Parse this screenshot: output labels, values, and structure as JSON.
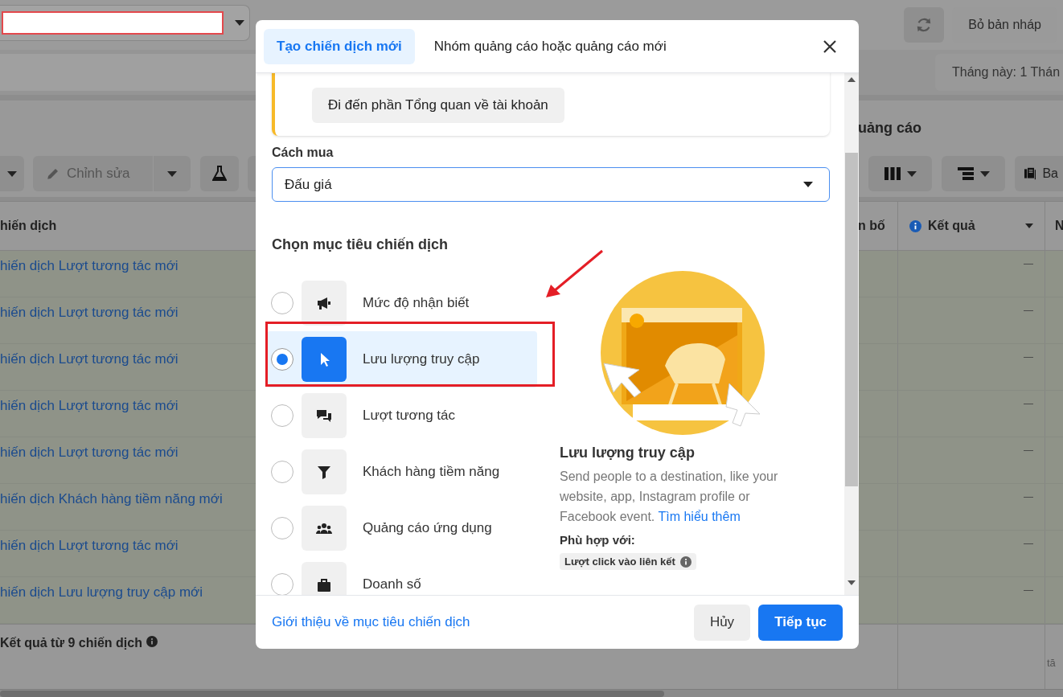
{
  "top_bar": {
    "draft_button": "Bỏ bản nháp"
  },
  "date_range": "Tháng này: 1 Thán",
  "panel_title": "uảng cáo",
  "toolbar": {
    "edit_label": "Chỉnh sửa",
    "partial_label": "Ba"
  },
  "table": {
    "columns": [
      {
        "label": "hiến dịch",
        "kind": "plain"
      },
      {
        "label": "n bố",
        "kind": "plain"
      },
      {
        "label": "Kết quả",
        "kind": "metric"
      },
      {
        "label": "N",
        "kind": "plain"
      }
    ],
    "rows": [
      {
        "name": "hiến dịch Lượt tương tác mới",
        "result": "—"
      },
      {
        "name": "hiến dịch Lượt tương tác mới",
        "result": "—"
      },
      {
        "name": "hiến dịch Lượt tương tác mới",
        "result": "—"
      },
      {
        "name": "hiến dịch Lượt tương tác mới",
        "result": "—"
      },
      {
        "name": "hiến dịch Lượt tương tác mới",
        "result": "—"
      },
      {
        "name": "hiến dịch Khách hàng tiềm năng mới",
        "result": "—"
      },
      {
        "name": "hiến dịch Lượt tương tác mới",
        "result": "—"
      },
      {
        "name": "hiến dịch Lưu lượng truy cập mới",
        "result": "—"
      }
    ],
    "footer": {
      "summary": "Kết quả từ 9 chiến dịch",
      "column_4": "tă"
    }
  },
  "dialog": {
    "tabs": [
      {
        "label": "Tạo chiến dịch mới",
        "selected": true
      },
      {
        "label": "Nhóm quảng cáo hoặc quảng cáo mới",
        "selected": false
      }
    ],
    "notice_button": "Đi đến phần Tổng quan về tài khoản",
    "buying_type": {
      "label": "Cách mua",
      "value": "Đấu giá"
    },
    "objectives_heading": "Chọn mục tiêu chiến dịch",
    "objectives": [
      {
        "label": "Mức độ nhận biết",
        "selected": false
      },
      {
        "label": "Lưu lượng truy cập",
        "selected": true
      },
      {
        "label": "Lượt tương tác",
        "selected": false
      },
      {
        "label": "Khách hàng tiềm năng",
        "selected": false
      },
      {
        "label": "Quảng cáo ứng dụng",
        "selected": false
      },
      {
        "label": "Doanh số",
        "selected": false
      }
    ],
    "detail": {
      "title": "Lưu lượng truy cập",
      "description": "Send people to a destination, like your website, app, Instagram profile or Facebook event.",
      "link": "Tìm hiểu thêm",
      "fits_label": "Phù hợp với:",
      "tags": [
        "Lượt click vào liên kết"
      ]
    },
    "footer_link": "Giới thiệu về mục tiêu chiến dịch",
    "buttons": [
      {
        "label": "Hủy",
        "kind": "secondary"
      },
      {
        "label": "Tiếp tục",
        "kind": "primary"
      }
    ]
  }
}
